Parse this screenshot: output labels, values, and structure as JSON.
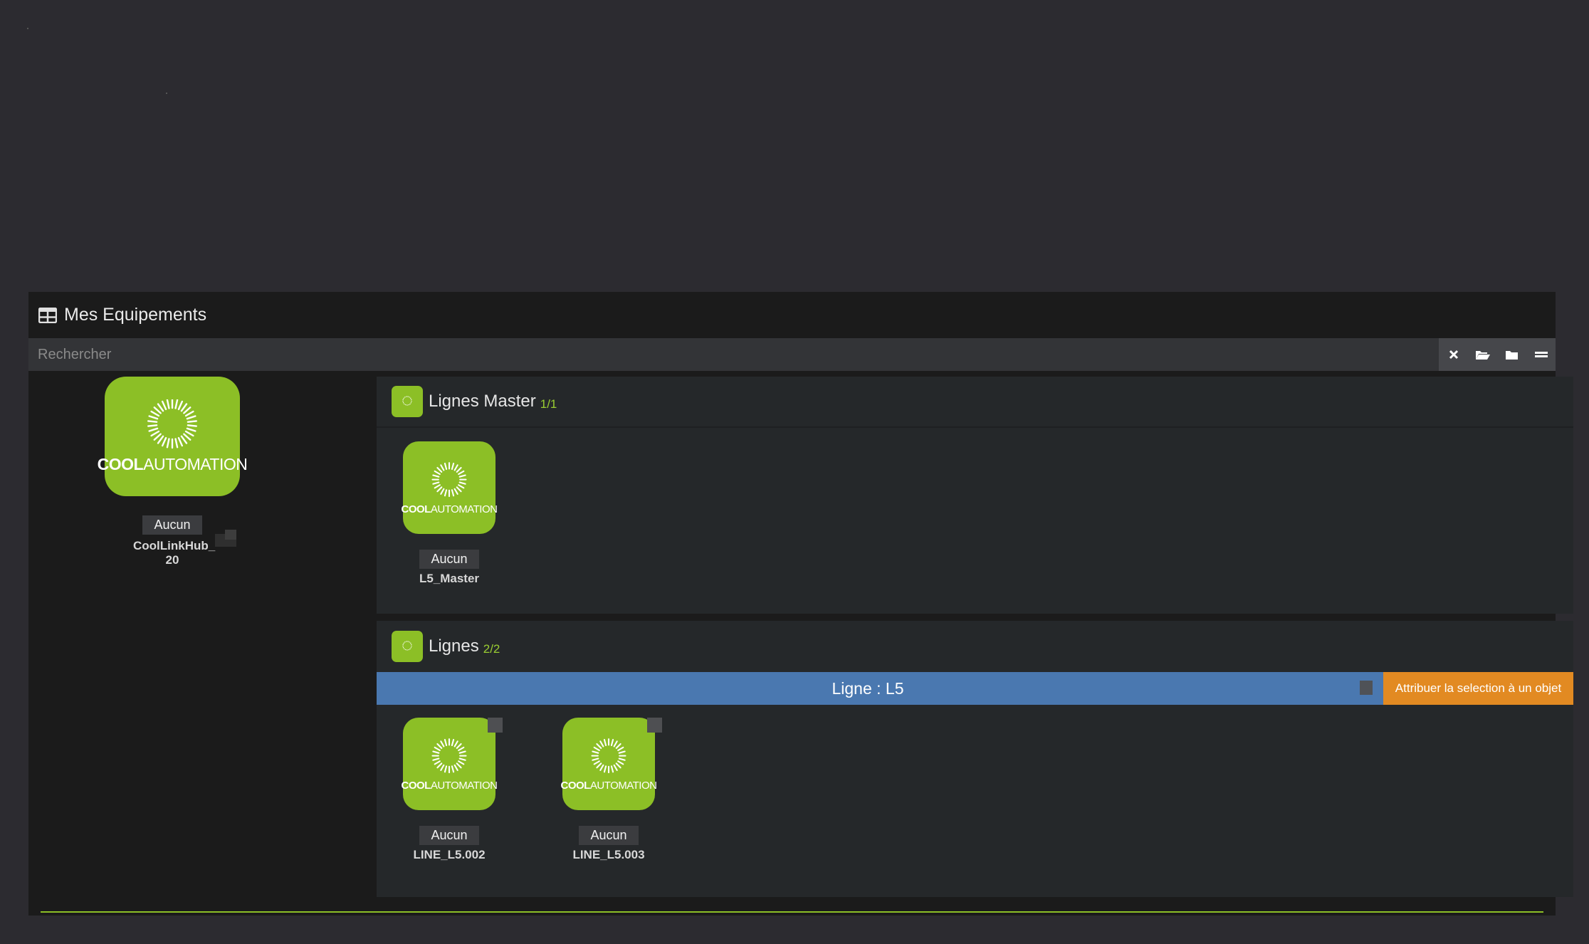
{
  "panel": {
    "title": "Mes Equipements"
  },
  "search": {
    "placeholder": "Rechercher",
    "buttons": [
      "close-icon",
      "folder-open-icon",
      "folder-icon",
      "menu-icon"
    ]
  },
  "logo": {
    "brand_bold": "COOL",
    "brand_light": "AUTOMATION"
  },
  "hub": {
    "object": "Aucun",
    "name": "CoolLinkHub_ 20"
  },
  "master_section": {
    "title": "Lignes Master",
    "count": "1/1",
    "items": [
      {
        "object": "Aucun",
        "name": "L5_Master"
      }
    ]
  },
  "lines_section": {
    "title": "Lignes",
    "count": "2/2",
    "line_label": "Ligne : L5",
    "assign_button": "Attribuer la selection à un objet",
    "items": [
      {
        "object": "Aucun",
        "name": "LINE_L5.002"
      },
      {
        "object": "Aucun",
        "name": "LINE_L5.003"
      }
    ]
  },
  "colors": {
    "accent": "#8cbf26",
    "line_bar": "#4a78b0",
    "assign": "#e28a22"
  }
}
